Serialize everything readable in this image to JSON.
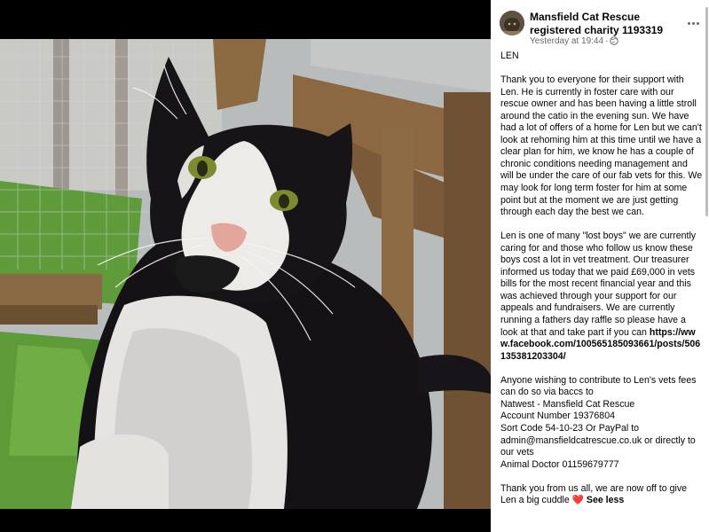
{
  "post": {
    "page_name": "Mansfield Cat Rescue registered charity 1193319",
    "timestamp": "Yesterday at 19:44",
    "separator": "·",
    "privacy_icon": "globe-icon",
    "more_icon": "more-horizontal-icon",
    "paragraphs": [
      "LEN",
      "Thank you to everyone for their support with Len. He is currently in foster care with our rescue owner and has been having a little stroll around the catio in the evening sun. We have had a lot of offers of a home for Len but we can't look at rehoming him at this time until we have a clear plan for him, we know he has a couple of chronic conditions needing management and will be under the care of our fab vets for this. We may look for long term foster for him at some point but at the moment we are just getting through each day the best we can.",
      "Len is one of many \"lost boys\" we are currently caring for and those who follow us know these boys cost a lot in vet treatment. Our treasurer informed us today that we paid £69,000 in vets bills for the most recent financial year and this was achieved through your support for our appeals and fundraisers. We are currently running a fathers day raffle so please have a look at that and take part if you can",
      "Anyone wishing to contribute to Len's vets fees can do so via baccs to\nNatwest - Mansfield Cat Rescue\nAccount Number 19376804\nSort Code 54-10-23 Or PayPal to admin@mansfieldcatrescue.co.uk or directly to our vets\nAnimal Doctor 01159679777",
      "Thank you from us all, we are now off to give Len a big cuddle"
    ],
    "link": "https://www.facebook.com/100565185093661/posts/506135381203304/",
    "heart_emoji": "❤️",
    "see_less": "See less"
  },
  "colors": {
    "text": "#050505",
    "secondary_text": "#65676b",
    "heart": "#e8334a",
    "background": "#000000",
    "panel": "#ffffff"
  }
}
